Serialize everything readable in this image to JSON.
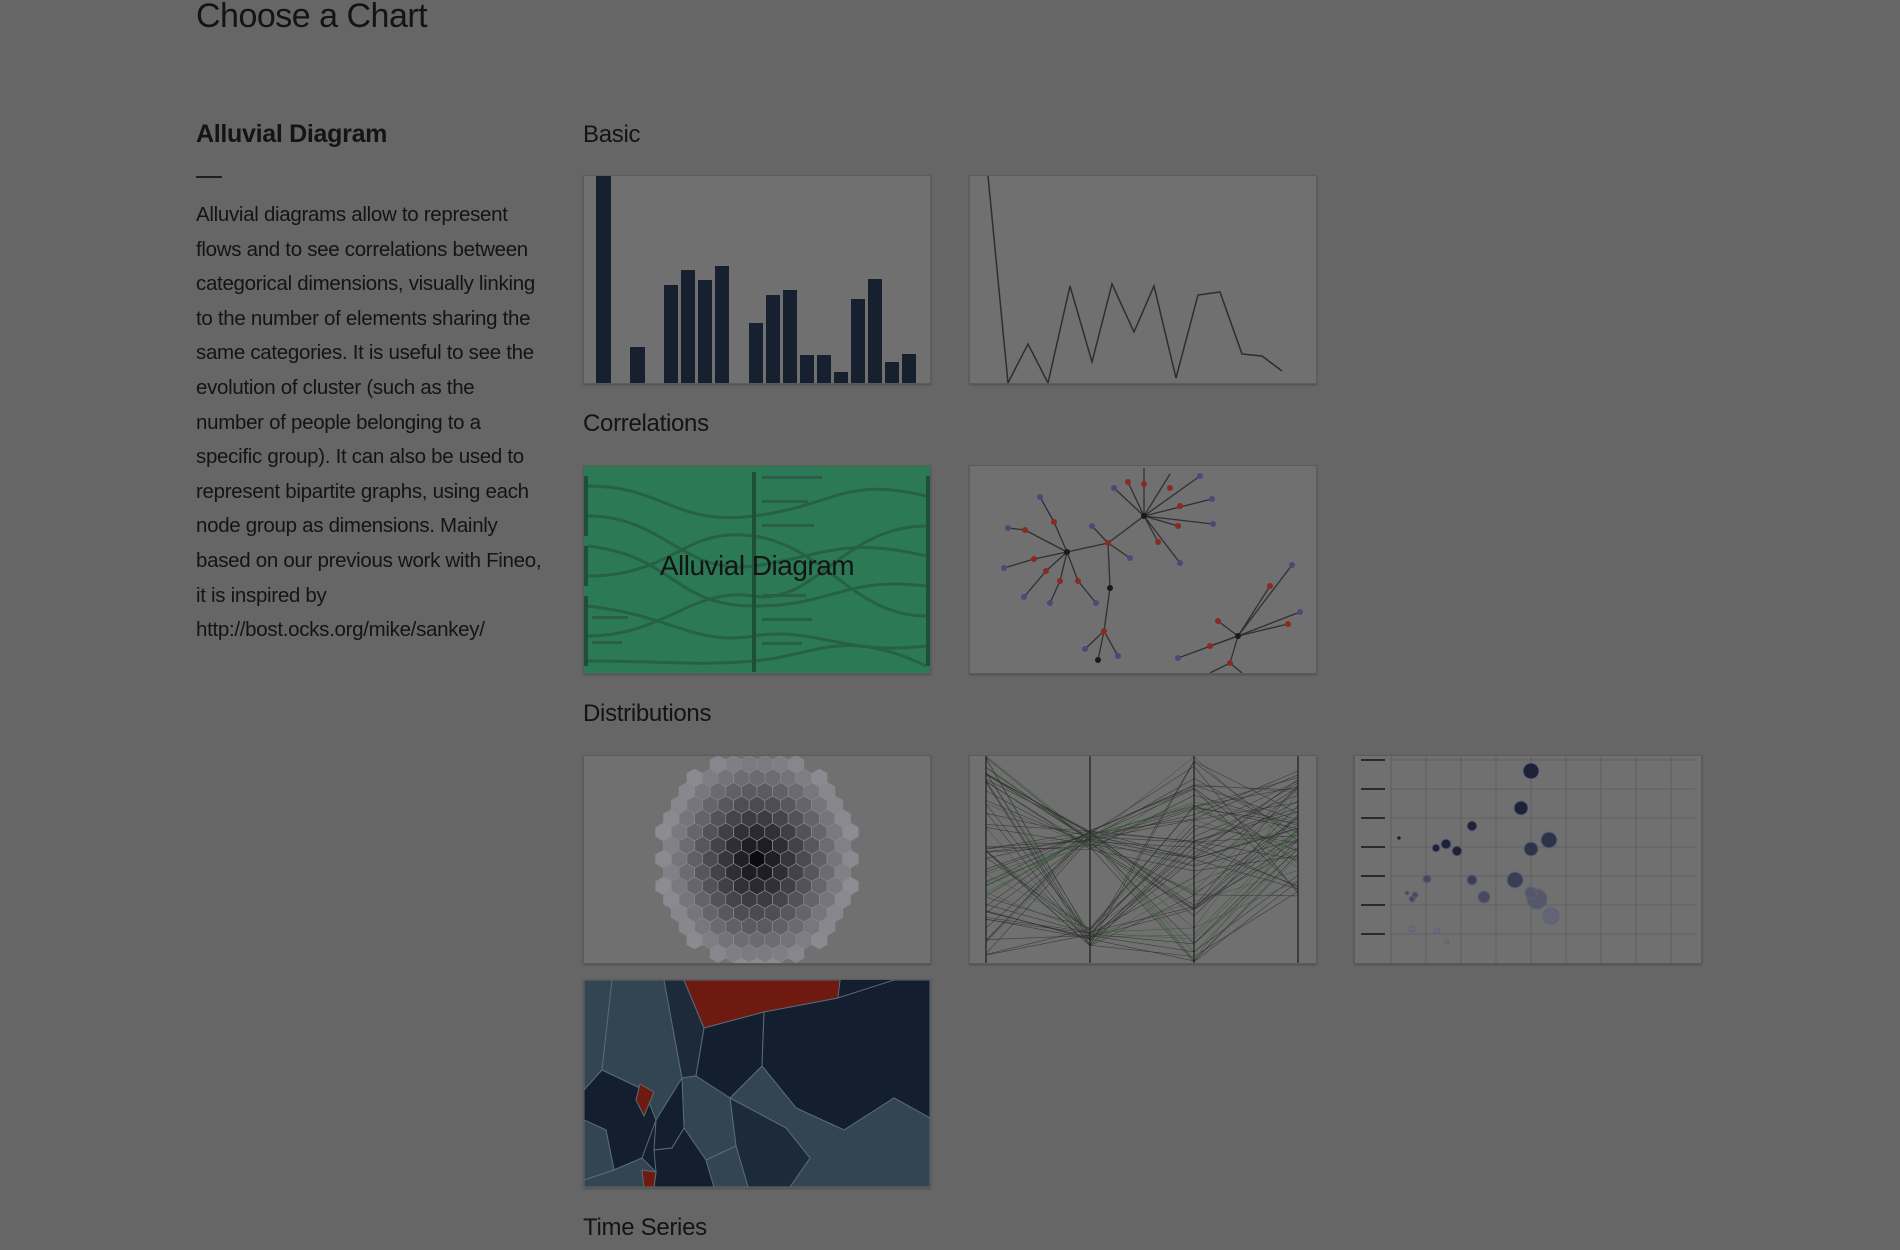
{
  "page": {
    "title": "Choose a Chart"
  },
  "selected_chart": {
    "name": "Alluvial Diagram",
    "description": "Alluvial diagrams allow to represent flows and to see correlations between categorical dimensions, visually linking to the number of elements sharing the same categories. It is useful to see the evolution of cluster (such as the number of people belonging to a specific group). It can also be used to represent bipartite graphs, using each node group as dimensions. Mainly based on our previous work with Fineo, it is inspired by http://bost.ocks.org/mike/sankey/"
  },
  "sections": {
    "basic": "Basic",
    "correlations": "Correlations",
    "distributions": "Distributions",
    "time_series": "Time Series"
  },
  "thumbnails": {
    "alluvial_label": "Alluvial Diagram"
  },
  "colors": {
    "overlay_background": "#666666",
    "selected_thumbnail": "#2c7a55",
    "bar_fill": "#17202e",
    "node_red": "#8a2a22",
    "node_blue": "#4a4a78",
    "voronoi_dark": "#131e2e",
    "voronoi_mid": "#324550",
    "voronoi_red": "#6e1a10"
  },
  "icons": [
    "bar-chart-thumbnail",
    "line-chart-thumbnail",
    "alluvial-thumbnail",
    "network-thumbnail",
    "hexbin-thumbnail",
    "parallel-coordinates-thumbnail",
    "bubble-chart-thumbnail",
    "voronoi-thumbnail"
  ]
}
